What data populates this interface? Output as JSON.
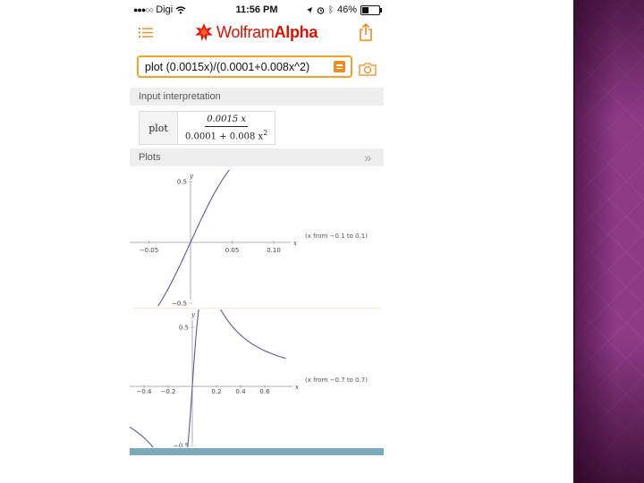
{
  "status": {
    "carrier": "Digi",
    "time": "11:56 PM",
    "battery": "46%",
    "battery_level": 0.46
  },
  "app": {
    "logo_part1": "Wolfram",
    "logo_part2": "Alpha"
  },
  "query": {
    "text": "plot (0.0015x)/(0.0001+0.008x^2)"
  },
  "input_interpretation": {
    "header": "Input interpretation",
    "command": "plot",
    "numerator": "0.0015 x",
    "denominator": "0.0001 + 0.008 x",
    "exponent": "2"
  },
  "plots_header": "Plots",
  "chart_data": [
    {
      "type": "line",
      "function": "(0.0015x)/(0.0001+0.008x^2)",
      "x_range": [
        -0.1,
        0.1
      ],
      "xlabel": "x",
      "ylabel": "y",
      "x_ticks": [
        "-0.05",
        "0.05",
        "0.10"
      ],
      "y_ticks": [
        "0.5",
        "-0.5"
      ],
      "annotation": "(x from −0.1 to 0.1)",
      "color": "#5a5a9a"
    },
    {
      "type": "line",
      "function": "(0.0015x)/(0.0001+0.008x^2)",
      "x_range": [
        -0.7,
        0.7
      ],
      "xlabel": "x",
      "ylabel": "y",
      "x_ticks": [
        "-0.4",
        "-0.2",
        "0.2",
        "0.4",
        "0.6"
      ],
      "y_ticks": [
        "0.5",
        "-0.5"
      ],
      "annotation": "(x from −0.7 to 0.7)",
      "color": "#5a5a9a"
    }
  ]
}
